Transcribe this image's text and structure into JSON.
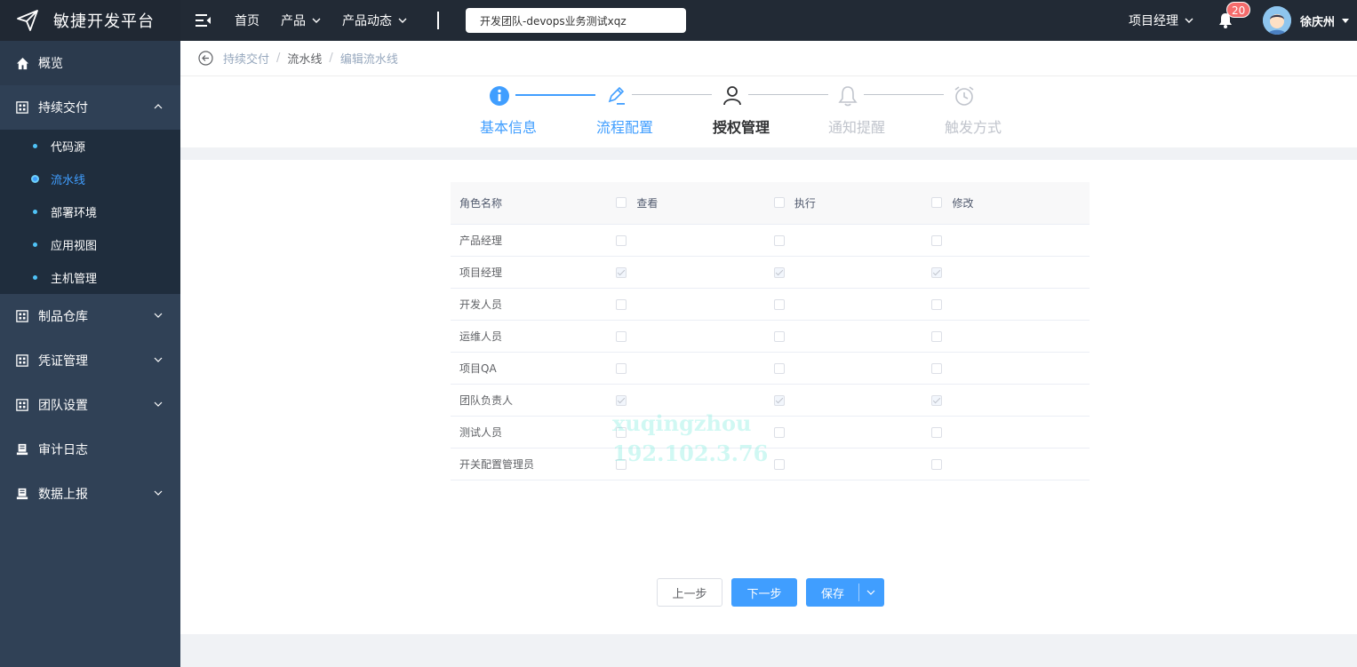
{
  "app": {
    "title": "敏捷开发平台"
  },
  "topnav": {
    "items": [
      {
        "label": "首页",
        "dropdown": false
      },
      {
        "label": "产品",
        "dropdown": true
      },
      {
        "label": "产品动态",
        "dropdown": true
      }
    ],
    "team_select": "开发团队-devops业务测试xqz",
    "role": "项目经理",
    "notification_count": "20",
    "username": "徐庆州"
  },
  "sidebar": {
    "items": [
      {
        "label": "概览",
        "icon": "home-icon"
      },
      {
        "label": "持续交付",
        "icon": "grid-icon",
        "expanded": true,
        "children": [
          {
            "label": "代码源",
            "active": false
          },
          {
            "label": "流水线",
            "active": true
          },
          {
            "label": "部署环境",
            "active": false
          },
          {
            "label": "应用视图",
            "active": false
          },
          {
            "label": "主机管理",
            "active": false
          }
        ]
      },
      {
        "label": "制品仓库",
        "icon": "grid-icon"
      },
      {
        "label": "凭证管理",
        "icon": "grid-icon"
      },
      {
        "label": "团队设置",
        "icon": "grid-icon"
      },
      {
        "label": "审计日志",
        "icon": "log-icon"
      },
      {
        "label": "数据上报",
        "icon": "log-icon"
      }
    ]
  },
  "breadcrumb": [
    "持续交付",
    "流水线",
    "编辑流水线"
  ],
  "steps": [
    {
      "label": "基本信息",
      "icon": "info-icon",
      "state": "done"
    },
    {
      "label": "流程配置",
      "icon": "edit-icon",
      "state": "done"
    },
    {
      "label": "授权管理",
      "icon": "user-icon",
      "state": "current"
    },
    {
      "label": "通知提醒",
      "icon": "bell-icon",
      "state": "pending"
    },
    {
      "label": "触发方式",
      "icon": "alarm-clock-icon",
      "state": "pending"
    }
  ],
  "permissions": {
    "headers": {
      "role": "角色名称",
      "view": "查看",
      "execute": "执行",
      "modify": "修改"
    },
    "rows": [
      {
        "role": "产品经理",
        "view": false,
        "execute": false,
        "modify": false
      },
      {
        "role": "项目经理",
        "view": true,
        "execute": true,
        "modify": true
      },
      {
        "role": "开发人员",
        "view": false,
        "execute": false,
        "modify": false
      },
      {
        "role": "运维人员",
        "view": false,
        "execute": false,
        "modify": false
      },
      {
        "role": "项目QA",
        "view": false,
        "execute": false,
        "modify": false
      },
      {
        "role": "团队负责人",
        "view": true,
        "execute": true,
        "modify": true
      },
      {
        "role": "测试人员",
        "view": false,
        "execute": false,
        "modify": false
      },
      {
        "role": "开关配置管理员",
        "view": false,
        "execute": false,
        "modify": false
      }
    ]
  },
  "watermark": [
    "xuqingzhou",
    "192.102.3.76"
  ],
  "buttons": {
    "prev": "上一步",
    "next": "下一步",
    "save": "保存"
  },
  "colors": {
    "primary": "#409eff",
    "sidebar_bg": "#304156",
    "topbar_bg": "#222a35",
    "badge": "#f56c6c"
  }
}
